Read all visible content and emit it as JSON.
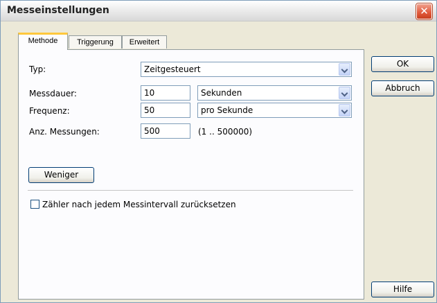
{
  "window": {
    "title": "Messeinstellungen",
    "close_glyph": "✕"
  },
  "tabs": [
    {
      "label": "Methode"
    },
    {
      "label": "Triggerung"
    },
    {
      "label": "Erweitert"
    }
  ],
  "form": {
    "typ": {
      "label": "Typ:",
      "value": "Zeitgesteuert"
    },
    "messdauer": {
      "label": "Messdauer:",
      "value": "10",
      "unit": "Sekunden"
    },
    "frequenz": {
      "label": "Frequenz:",
      "value": "50",
      "unit": "pro Sekunde"
    },
    "anzahl": {
      "label": "Anz. Messungen:",
      "value": "500",
      "range": "(1 .. 500000)"
    },
    "weniger_label": "Weniger",
    "reset_checkbox": {
      "label": "Zähler nach jedem Messintervall zurücksetzen",
      "checked": false
    }
  },
  "buttons": {
    "ok": "OK",
    "abbruch": "Abbruch",
    "hilfe": "Hilfe"
  }
}
